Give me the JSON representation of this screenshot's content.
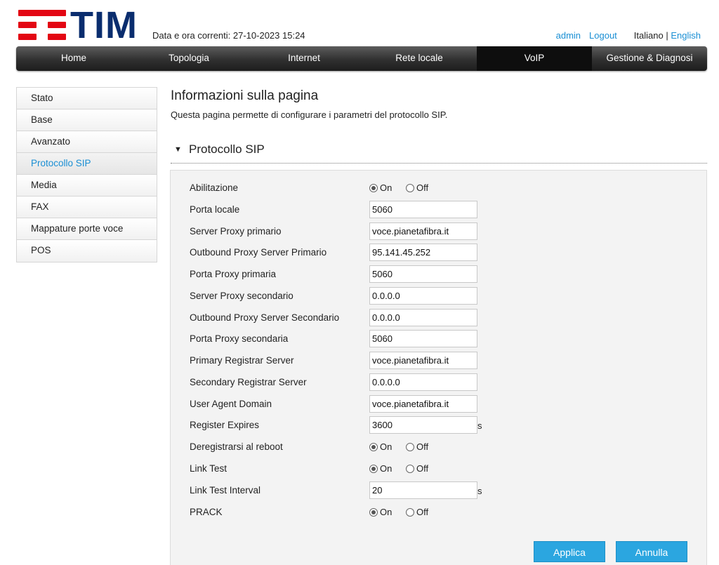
{
  "header": {
    "logo_text": "TIM",
    "datetime": "Data e ora correnti: 27-10-2023 15:24",
    "user": "admin",
    "logout": "Logout",
    "lang_current": "Italiano",
    "lang_separator": "|",
    "lang_other": "English"
  },
  "nav": {
    "items": [
      "Home",
      "Topologia",
      "Internet",
      "Rete locale",
      "VoIP",
      "Gestione & Diagnosi"
    ],
    "active": "VoIP"
  },
  "sidebar": {
    "items": [
      "Stato",
      "Base",
      "Avanzato",
      "Protocollo SIP",
      "Media",
      "FAX",
      "Mappature porte voce",
      "POS"
    ],
    "active": "Protocollo SIP"
  },
  "page": {
    "title": "Informazioni sulla pagina",
    "description": "Questa pagina permette di configurare i parametri del protocollo SIP."
  },
  "section": {
    "arrow": "▼",
    "title": "Protocollo SIP"
  },
  "radio_labels": {
    "on": "On",
    "off": "Off"
  },
  "form": {
    "abilitazione": {
      "label": "Abilitazione",
      "value": "On"
    },
    "porta_locale": {
      "label": "Porta locale",
      "value": "5060"
    },
    "server_proxy_primario": {
      "label": "Server Proxy primario",
      "value": "voce.pianetafibra.it"
    },
    "outbound_proxy_primario": {
      "label": "Outbound Proxy Server Primario",
      "value": "95.141.45.252"
    },
    "porta_proxy_primaria": {
      "label": "Porta Proxy primaria",
      "value": "5060"
    },
    "server_proxy_secondario": {
      "label": "Server Proxy secondario",
      "value": "0.0.0.0"
    },
    "outbound_proxy_secondario": {
      "label": "Outbound Proxy Server Secondario",
      "value": "0.0.0.0"
    },
    "porta_proxy_secondaria": {
      "label": "Porta Proxy secondaria",
      "value": "5060"
    },
    "primary_registrar": {
      "label": "Primary Registrar Server",
      "value": "voce.pianetafibra.it"
    },
    "secondary_registrar": {
      "label": "Secondary Registrar Server",
      "value": "0.0.0.0"
    },
    "user_agent_domain": {
      "label": "User Agent Domain",
      "value": "voce.pianetafibra.it"
    },
    "register_expires": {
      "label": "Register Expires",
      "value": "3600",
      "unit": "s"
    },
    "deregistrarsi": {
      "label": "Deregistrarsi al reboot",
      "value": "On"
    },
    "link_test": {
      "label": "Link Test",
      "value": "On"
    },
    "link_test_interval": {
      "label": "Link Test Interval",
      "value": "20",
      "unit": "s"
    },
    "prack": {
      "label": "PRACK",
      "value": "On"
    }
  },
  "buttons": {
    "apply": "Applica",
    "cancel": "Annulla"
  },
  "colors": {
    "accent": "#1a8fd4",
    "brand_red": "#e30613",
    "brand_blue": "#0a2d6e",
    "button": "#2ba6e0"
  }
}
